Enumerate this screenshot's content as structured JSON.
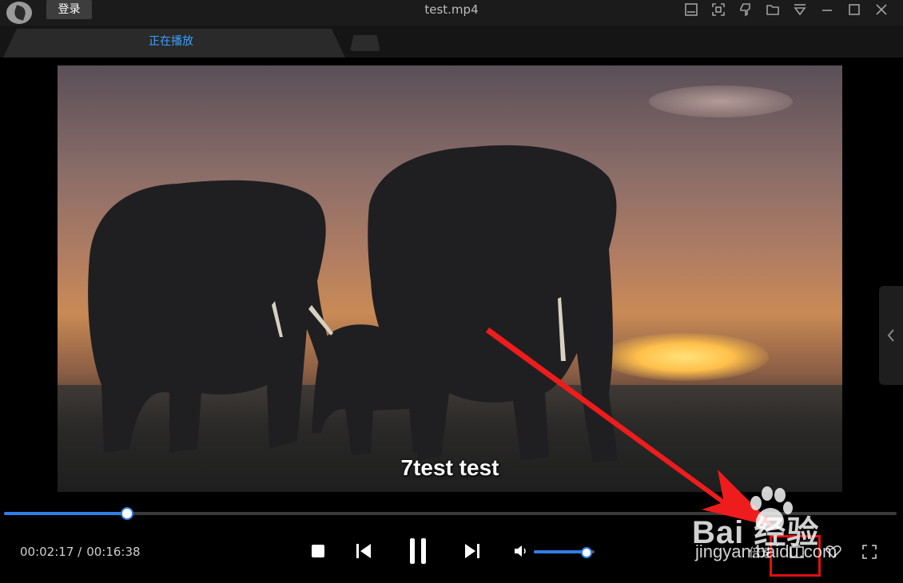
{
  "titlebar": {
    "login_label": "登录",
    "window_title": "test.mp4",
    "icons": [
      "subtitle-icon",
      "screenshot-icon",
      "pin-icon",
      "folder-icon",
      "menu-icon",
      "minimize-icon",
      "maximize-icon",
      "close-icon"
    ]
  },
  "tabs": [
    {
      "label": "正在播放",
      "active": true
    }
  ],
  "video": {
    "subtitle": "7test test"
  },
  "player": {
    "current_time": "00:02:17 /",
    "total_time": "00:16:38",
    "progress": 0.137,
    "volume": 0.86,
    "speed_label": "倍速",
    "accent_color": "#2f7fe6"
  },
  "watermark": {
    "brand": "Bai 经验",
    "url": "jingyan.baidu.com"
  }
}
